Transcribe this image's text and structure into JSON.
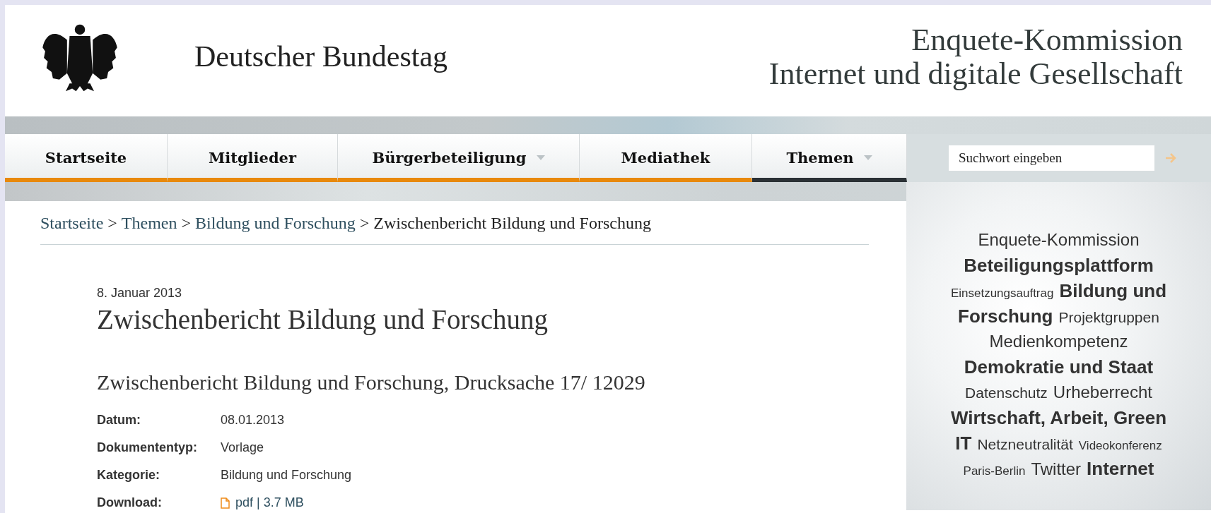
{
  "header": {
    "site_name": "Deutscher Bundestag",
    "commission_title": [
      "Enquete-Kommission",
      "Internet und digitale Gesellschaft"
    ]
  },
  "nav": [
    {
      "label": "Startseite",
      "selected": false,
      "has_menu": false
    },
    {
      "label": "Mitglieder",
      "selected": false,
      "has_menu": false
    },
    {
      "label": "Bürgerbeteiligung",
      "selected": false,
      "has_menu": true
    },
    {
      "label": "Mediathek",
      "selected": false,
      "has_menu": false
    },
    {
      "label": "Themen",
      "selected": true,
      "has_menu": true
    }
  ],
  "search": {
    "placeholder": "Suchwort eingeben"
  },
  "breadcrumb": [
    {
      "label": "Startseite",
      "link": true
    },
    {
      "label": "Themen",
      "link": true
    },
    {
      "label": "Bildung und Forschung",
      "link": true
    },
    {
      "label": "Zwischenbericht Bildung und Forschung",
      "link": false
    }
  ],
  "breadcrumb_separator": ">",
  "article": {
    "date": "8. Januar 2013",
    "title": "Zwischenbericht Bildung und Forschung",
    "subtitle": "Zwischenbericht Bildung und Forschung, Drucksache 17/ 12029",
    "meta": [
      {
        "label": "Datum:",
        "value": "08.01.2013",
        "kind": "text"
      },
      {
        "label": "Dokumententyp:",
        "value": "Vorlage",
        "kind": "text"
      },
      {
        "label": "Kategorie:",
        "value": "Bildung und Forschung",
        "kind": "text"
      },
      {
        "label": "Download:",
        "value": "pdf | 3.7 MB",
        "kind": "file"
      }
    ]
  },
  "tag_cloud_lines": [
    [
      {
        "label": "Enquete-Kommission",
        "kind": "medium"
      }
    ],
    [
      {
        "label": "Beteiligungsplattform",
        "kind": "large"
      }
    ],
    [
      {
        "label": "Einsetzungsauftrag",
        "kind": "tiny"
      },
      {
        "label": "Bildung und",
        "kind": "large"
      }
    ],
    [
      {
        "label": "Forschung",
        "kind": "large"
      },
      {
        "label": "Projektgruppen",
        "kind": "small"
      }
    ],
    [
      {
        "label": "Medienkompetenz",
        "kind": "medium"
      }
    ],
    [
      {
        "label": "Demokratie und Staat",
        "kind": "large"
      }
    ],
    [
      {
        "label": "Datenschutz",
        "kind": "small"
      },
      {
        "label": "Urheberrecht",
        "kind": "medium"
      }
    ],
    [
      {
        "label": "Wirtschaft, Arbeit, Green",
        "kind": "large"
      }
    ],
    [
      {
        "label": "IT",
        "kind": "large"
      },
      {
        "label": "Netzneutralität",
        "kind": "small"
      },
      {
        "label": "Videokonferenz",
        "kind": "tiny"
      }
    ],
    [
      {
        "label": "Paris-Berlin",
        "kind": "tiny"
      },
      {
        "label": "Twitter",
        "kind": "medium"
      },
      {
        "label": "Internet",
        "kind": "large"
      }
    ]
  ]
}
